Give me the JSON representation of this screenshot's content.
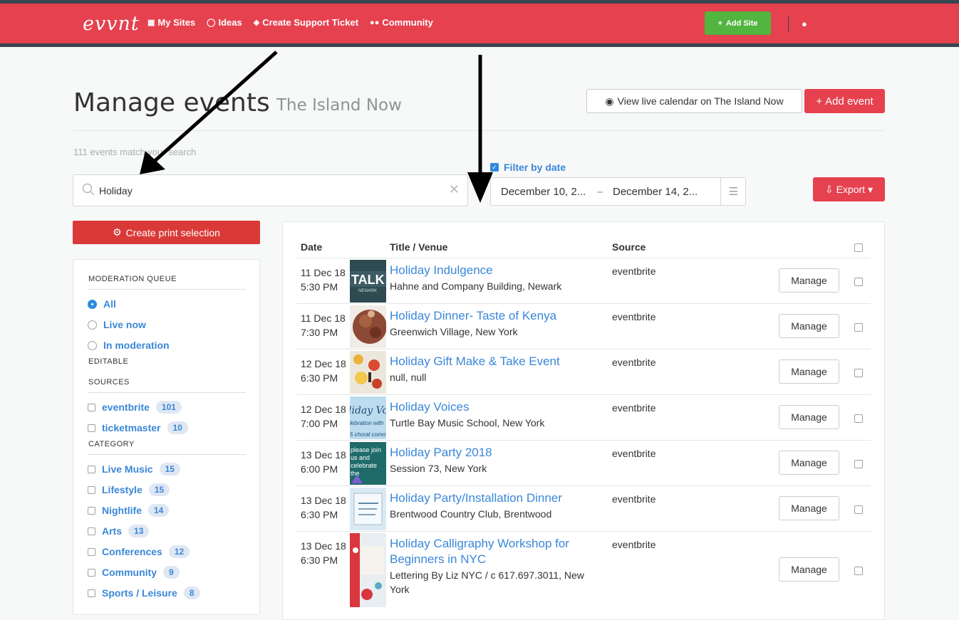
{
  "header": {
    "logo": "evvnt",
    "nav": [
      {
        "icon": "sitemap-icon",
        "label": "My Sites"
      },
      {
        "icon": "lightbulb-icon",
        "label": "Ideas"
      },
      {
        "icon": "ticket-icon",
        "label": "Create Support Ticket"
      },
      {
        "icon": "users-icon",
        "label": "Community"
      }
    ],
    "add_site_label": "Add Site"
  },
  "page": {
    "title": "Manage events",
    "subtitle": "The Island Now",
    "view_live_label": "View live calendar on The Island Now",
    "add_event_label": "Add event",
    "match_count": "111 events match your search"
  },
  "search": {
    "value": "Holiday"
  },
  "date_filter": {
    "label": "Filter by date",
    "checked": true,
    "from": "December 10, 2...",
    "to": "December 14, 2..."
  },
  "export_label": "Export",
  "print_selection_label": "Create print selection",
  "sidebar": {
    "moderation_heading": "MODERATION QUEUE",
    "moderation_options": [
      {
        "label": "All",
        "selected": true
      },
      {
        "label": "Live now",
        "selected": false
      },
      {
        "label": "In moderation",
        "selected": false
      }
    ],
    "editable_heading": "EDITABLE",
    "sources_heading": "SOURCES",
    "sources": [
      {
        "label": "eventbrite",
        "count": "101"
      },
      {
        "label": "ticketmaster",
        "count": "10"
      }
    ],
    "category_heading": "CATEGORY",
    "categories": [
      {
        "label": "Live Music",
        "count": "15"
      },
      {
        "label": "Lifestyle",
        "count": "15"
      },
      {
        "label": "Nightlife",
        "count": "14"
      },
      {
        "label": "Arts",
        "count": "13"
      },
      {
        "label": "Conferences",
        "count": "12"
      },
      {
        "label": "Community",
        "count": "9"
      },
      {
        "label": "Sports / Leisure",
        "count": "8"
      }
    ]
  },
  "table": {
    "headers": {
      "date": "Date",
      "title": "Title / Venue",
      "source": "Source"
    },
    "manage_label": "Manage",
    "rows": [
      {
        "date": "11 Dec 18",
        "time": "5:30 PM",
        "title": "Holiday Indulgence",
        "venue": "Hahne and Company Building, Newark",
        "source": "eventbrite",
        "thumb": "talk"
      },
      {
        "date": "11 Dec 18",
        "time": "7:30 PM",
        "title": "Holiday Dinner- Taste of Kenya",
        "venue": "Greenwich Village, New York",
        "source": "eventbrite",
        "thumb": "food"
      },
      {
        "date": "12 Dec 18",
        "time": "6:30 PM",
        "title": "Holiday Gift Make & Take Event",
        "venue": "null, null",
        "source": "eventbrite",
        "thumb": "fruit"
      },
      {
        "date": "12 Dec 18",
        "time": "7:00 PM",
        "title": "Holiday Voices",
        "venue": "Turtle Bay Music School, New York",
        "source": "eventbrite",
        "thumb": "voices"
      },
      {
        "date": "13 Dec 18",
        "time": "6:00 PM",
        "title": "Holiday Party 2018",
        "venue": "Session 73, New York",
        "source": "eventbrite",
        "thumb": "party"
      },
      {
        "date": "13 Dec 18",
        "time": "6:30 PM",
        "title": "Holiday Party/Installation Dinner",
        "venue": "Brentwood Country Club, Brentwood",
        "source": "eventbrite",
        "thumb": "install"
      },
      {
        "date": "13 Dec 18",
        "time": "6:30 PM",
        "title": "Holiday Calligraphy Workshop for Beginners in NYC",
        "venue": "Lettering By Liz NYC / c 617.697.3011, New York",
        "source": "eventbrite",
        "thumb": "calligraphy"
      }
    ]
  },
  "thumb_text": {
    "talk": "TALK",
    "talk_sub": "NEWARK",
    "voices": "liday Vo",
    "voices_sub": "lebration with",
    "voices_sub2": "5 choral comm",
    "party": "please join us and celebrate the holidays!"
  },
  "colors": {
    "brand_red": "#e5414f",
    "dark_bar": "#37464f",
    "link_blue": "#3a87d8",
    "green": "#52b540"
  }
}
